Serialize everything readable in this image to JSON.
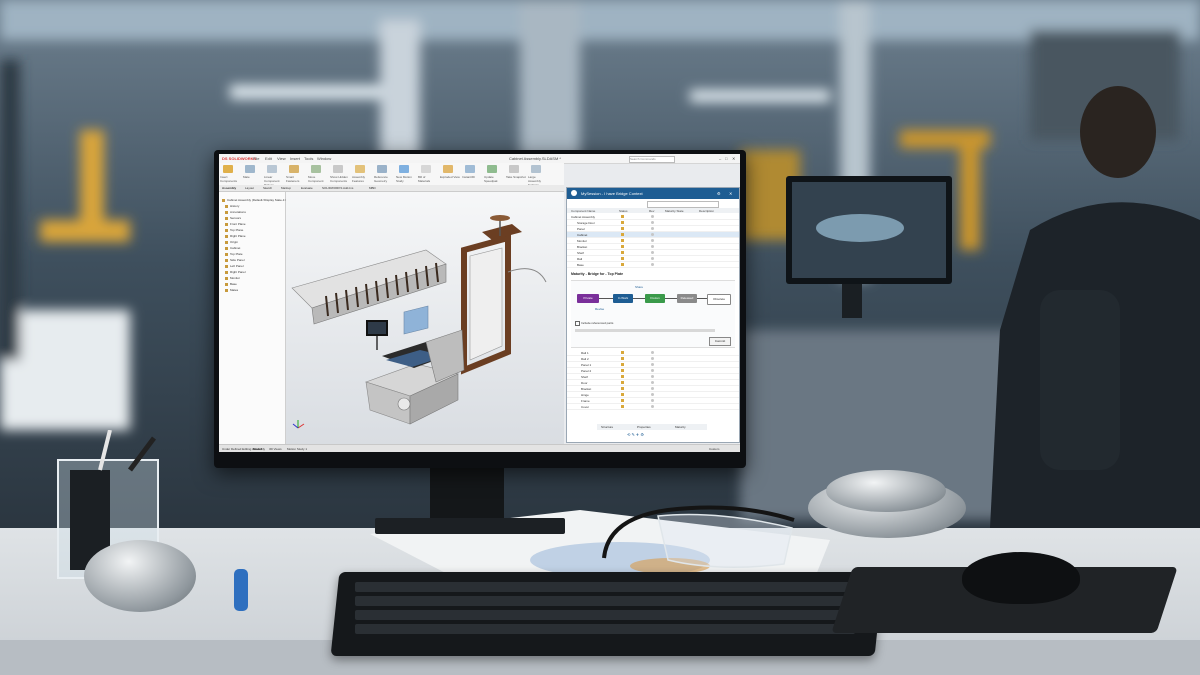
{
  "window": {
    "app_logo": "DS SOLIDWORKS",
    "title": "Cabinet Assembly.SLDASM *",
    "search_placeholder": "Search Commands",
    "menu": [
      "File",
      "Edit",
      "View",
      "Insert",
      "Tools",
      "Window"
    ]
  },
  "ribbon": {
    "buttons": [
      "Insert Components",
      "Mate",
      "Linear Component Pattern",
      "Smart Fasteners",
      "Move Component",
      "Show Hidden Components",
      "Assembly Features",
      "Reference Geometry",
      "New Motion Study",
      "Bill of Materials",
      "Exploded View",
      "Instant3D",
      "Update Speedpak",
      "Take Snapshot",
      "Large Assembly Settings"
    ],
    "tabs": [
      "Assembly",
      "Layout",
      "Sketch",
      "Markup",
      "Evaluate",
      "SOLIDWORKS Add-Ins",
      "MBD"
    ]
  },
  "tree": {
    "items": [
      "Cabinet Assembly (Default<Display State-1>)",
      "History",
      "Annotations",
      "Sensors",
      "Front Plane",
      "Top Plane",
      "Right Plane",
      "Origin",
      "Cabinet",
      "Top Plate",
      "Side Panel",
      "Left Panel",
      "Right Panel",
      "Monitor",
      "Base",
      "Mates"
    ]
  },
  "panel": {
    "title": "MySession - I have Bridge Context",
    "columns": [
      "Component Name",
      "Status",
      "Rev",
      "Maturity State",
      "Description"
    ],
    "rows_top": [
      "Cabinet Assembly",
      "Storage Door",
      "Panel",
      "Cabinet",
      "Monitor",
      "Bracket",
      "Shelf",
      "Rail",
      "Base"
    ],
    "flow_title": "Maturity - Bridge for - Top Plate",
    "flow_nodes": [
      "Private",
      "In Work",
      "Frozen",
      "Released",
      "Obsolete"
    ],
    "flow_link_labels": [
      "Share",
      "Revise"
    ],
    "flow_checkbox": "Include referenced parts",
    "flow_button": "Commit",
    "rows_bottom": [
      "Rail 1",
      "Rail 2",
      "Panel 1",
      "Panel 2",
      "Shelf",
      "Door",
      "Bracket",
      "Hinge",
      "Frame",
      "Cover"
    ],
    "tabs": [
      "Structure",
      "Properties",
      "Maturity"
    ]
  },
  "statusbar": {
    "left": "Under Defined Editing Assembly",
    "tabs": [
      "Model",
      "3D Views",
      "Motion Study 1"
    ],
    "right": "Custom"
  }
}
